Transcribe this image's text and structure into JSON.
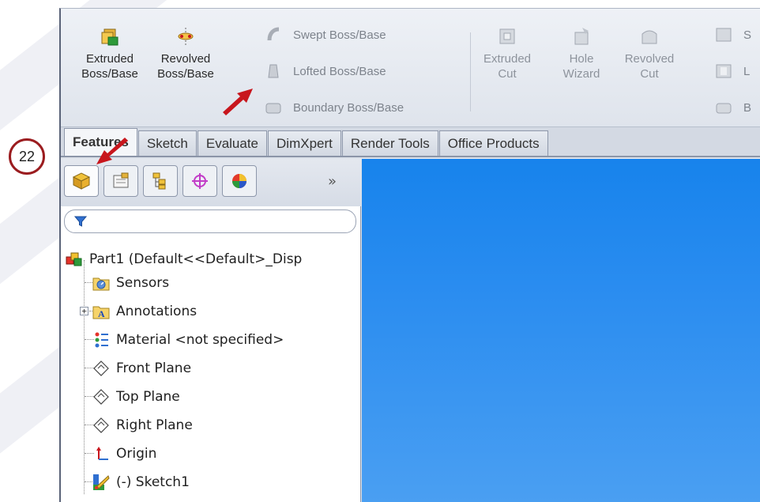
{
  "step_badge": "22",
  "ribbon": {
    "big_buttons": [
      {
        "label_line1": "Extruded",
        "label_line2": "Boss/Base",
        "icon": "extruded-boss-icon",
        "enabled": true
      },
      {
        "label_line1": "Revolved",
        "label_line2": "Boss/Base",
        "icon": "revolved-boss-icon",
        "enabled": true
      },
      {
        "label_line1": "Extruded",
        "label_line2": "Cut",
        "icon": "extruded-cut-icon",
        "enabled": false
      },
      {
        "label_line1": "Hole",
        "label_line2": "Wizard",
        "icon": "hole-wizard-icon",
        "enabled": false
      },
      {
        "label_line1": "Revolved",
        "label_line2": "Cut",
        "icon": "revolved-cut-icon",
        "enabled": false
      }
    ],
    "small_buttons": [
      {
        "label": "Swept Boss/Base",
        "icon": "swept-boss-icon"
      },
      {
        "label": "Lofted Boss/Base",
        "icon": "lofted-boss-icon"
      },
      {
        "label": "Boundary Boss/Base",
        "icon": "boundary-boss-icon"
      }
    ],
    "cut_small_buttons": [
      {
        "label": "S",
        "icon": "swept-cut-icon"
      },
      {
        "label": "L",
        "icon": "lofted-cut-icon"
      },
      {
        "label": "B",
        "icon": "boundary-cut-icon"
      }
    ]
  },
  "tabs": [
    {
      "label": "Features",
      "active": true
    },
    {
      "label": "Sketch",
      "active": false
    },
    {
      "label": "Evaluate",
      "active": false
    },
    {
      "label": "DimXpert",
      "active": false
    },
    {
      "label": "Render Tools",
      "active": false
    },
    {
      "label": "Office Products",
      "active": false
    }
  ],
  "feature_manager": {
    "panel_tabs": [
      "featuremanager-tree-icon",
      "property-manager-icon",
      "configuration-manager-icon",
      "dimxpert-manager-icon",
      "display-manager-icon"
    ],
    "more_label": "»",
    "tree": [
      {
        "label": "Part1  (Default<<Default>_Disp",
        "icon": "part-icon"
      },
      {
        "label": "Sensors",
        "icon": "sensors-folder-icon"
      },
      {
        "label": "Annotations",
        "icon": "annotations-folder-icon"
      },
      {
        "label": "Material <not specified>",
        "icon": "material-icon"
      },
      {
        "label": "Front Plane",
        "icon": "plane-icon"
      },
      {
        "label": "Top Plane",
        "icon": "plane-icon"
      },
      {
        "label": "Right Plane",
        "icon": "plane-icon"
      },
      {
        "label": "Origin",
        "icon": "origin-icon"
      },
      {
        "label": "(-) Sketch1",
        "icon": "sketch-icon"
      }
    ]
  },
  "colors": {
    "arrow": "#c8161d",
    "badge_ring": "#9b1c1f",
    "viewport_top": "#1783ec",
    "viewport_bottom": "#4a9ff2"
  }
}
